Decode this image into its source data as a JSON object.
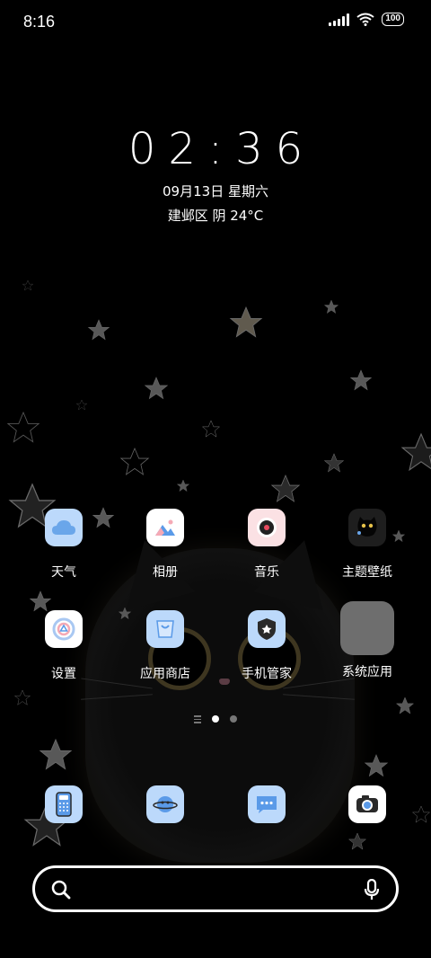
{
  "status_bar": {
    "time": "8:16",
    "battery": "100"
  },
  "clock": {
    "time": "02:36",
    "date": "09月13日 星期六",
    "weather": "建邺区 阴 24°C"
  },
  "apps": {
    "weather": "天气",
    "gallery": "相册",
    "music": "音乐",
    "themes": "主题壁纸",
    "settings": "设置",
    "app_store": "应用商店",
    "security": "手机管家",
    "system_apps": "系统应用"
  },
  "dock": [
    "phone-icon",
    "browser-icon",
    "messages-icon",
    "camera-icon"
  ],
  "page_indicator": {
    "pages": 2,
    "current": 1
  },
  "colors": {
    "icon_blue": "#bcd9fb",
    "background": "#000000"
  }
}
